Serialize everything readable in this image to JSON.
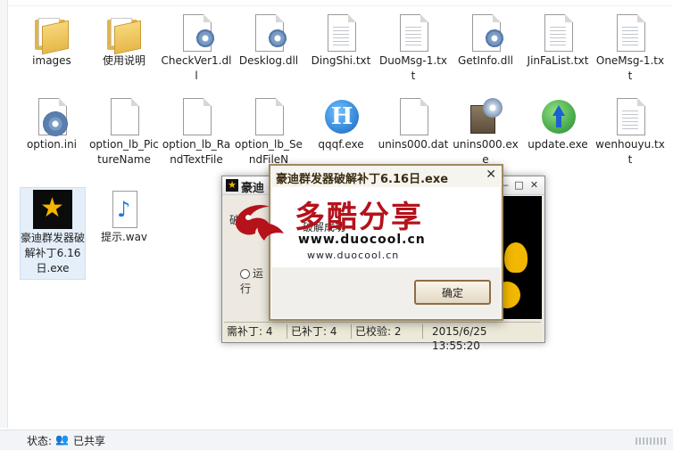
{
  "explorer": {
    "files": [
      {
        "name": "images",
        "icon": "folder-icon"
      },
      {
        "name": "使用说明",
        "icon": "folder-icon"
      },
      {
        "name": "CheckVer1.dll",
        "icon": "dll-file-icon"
      },
      {
        "name": "Desklog.dll",
        "icon": "dll-file-icon"
      },
      {
        "name": "DingShi.txt",
        "icon": "text-file-icon"
      },
      {
        "name": "DuoMsg-1.txt",
        "icon": "text-file-icon"
      },
      {
        "name": "GetInfo.dll",
        "icon": "dll-file-icon"
      },
      {
        "name": "JinFaList.txt",
        "icon": "text-file-icon"
      },
      {
        "name": "OneMsg-1.txt",
        "icon": "text-file-icon"
      },
      {
        "name": "option.ini",
        "icon": "ini-settings-icon"
      },
      {
        "name": "option_lb_PictureName",
        "icon": "blank-file-icon"
      },
      {
        "name": "option_lb_RandTextFile",
        "icon": "blank-file-icon"
      },
      {
        "name": "option_lb_SendFileN",
        "icon": "blank-file-icon"
      },
      {
        "name": "qqqf.exe",
        "icon": "h-app-icon"
      },
      {
        "name": "unins000.dat",
        "icon": "blank-file-icon"
      },
      {
        "name": "unins000.exe",
        "icon": "installer-icon"
      },
      {
        "name": "update.exe",
        "icon": "update-globe-icon"
      },
      {
        "name": "wenhouyu.txt",
        "icon": "text-file-icon"
      },
      {
        "name": "豪迪群发器破解补丁6.16日.exe",
        "icon": "haodi-app-icon"
      },
      {
        "name": "提示.wav",
        "icon": "audio-file-icon"
      }
    ],
    "status_label": "状态:",
    "status_value": "已共享"
  },
  "app_window": {
    "title": "豪迪",
    "side_text_1": "破解",
    "side_text_2": "运行",
    "statusbar": {
      "need": "需补丁: 4",
      "patched": "已补丁: 4",
      "verified": "已校验: 2",
      "datetime": "2015/6/25 13:55:20"
    }
  },
  "dialog": {
    "title": "豪迪群发器破解补丁6.16日.exe",
    "message": "破解成功",
    "ok_label": "确定"
  },
  "watermark": {
    "brand_cn": "多酷分享",
    "url_big": "www.duocool.cn",
    "url_small": "www.duocool.cn"
  }
}
